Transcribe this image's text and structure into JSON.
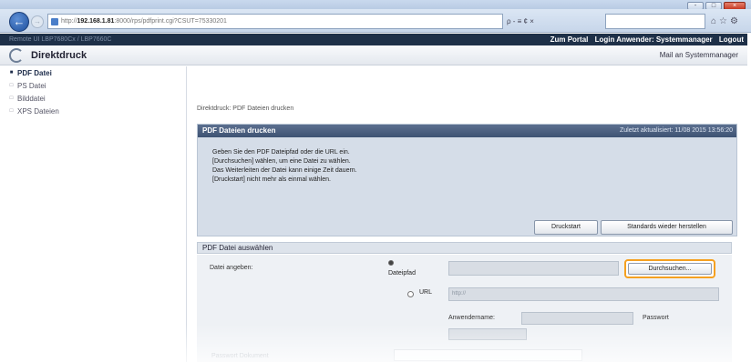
{
  "browser": {
    "url_prefix": "http://",
    "url_host": "192.168.1.81",
    "url_rest": ":8000/rps/pdfprint.cgi?CSUT=75330201",
    "search_tools": "ρ - ≡ ¢ ×",
    "window_controls": [
      "-",
      "□",
      "×"
    ]
  },
  "device": {
    "left_text": "Remote UI   LBP7680Cx / LBP7660C",
    "links": [
      "Zum Portal",
      "Login Anwender: Systemmanager",
      "Logout"
    ]
  },
  "header": {
    "title": "Direktdruck",
    "mail_link": "Mail an Systemmanager"
  },
  "sidebar": {
    "items": [
      {
        "label": "PDF Datei",
        "bullet": "■"
      },
      {
        "label": "PS Datei",
        "bullet": "□"
      },
      {
        "label": "Bilddatei",
        "bullet": "□"
      },
      {
        "label": "XPS Dateien",
        "bullet": "□"
      }
    ]
  },
  "main": {
    "breadcrumb": "Direktdruck: PDF Dateien drucken",
    "panel_title": "PDF Dateien drucken",
    "last_updated": "Zuletzt aktualisiert: 11/08 2015 13:56:20",
    "instructions": [
      "Geben Sie den PDF Dateipfad oder die URL ein.",
      "[Durchsuchen] wählen, um eine Datei zu wählen.",
      "Das Weiterleiten der Datei kann einige Zeit dauern.",
      "[Druckstart] nicht mehr als einmal wählen."
    ],
    "start_button": "Druckstart",
    "default_button": "Standards wieder herstellen",
    "section_title": "PDF Datei auswählen",
    "field_label": "Datei angeben:",
    "radio_file": "Dateipfad",
    "browse_button": "Durchsuchen...",
    "radio_url": "URL",
    "url_placeholder": "http://",
    "username_label": "Anwendername:",
    "password_label": "Passwort",
    "doc_password_label": "Passwort Dokument"
  }
}
